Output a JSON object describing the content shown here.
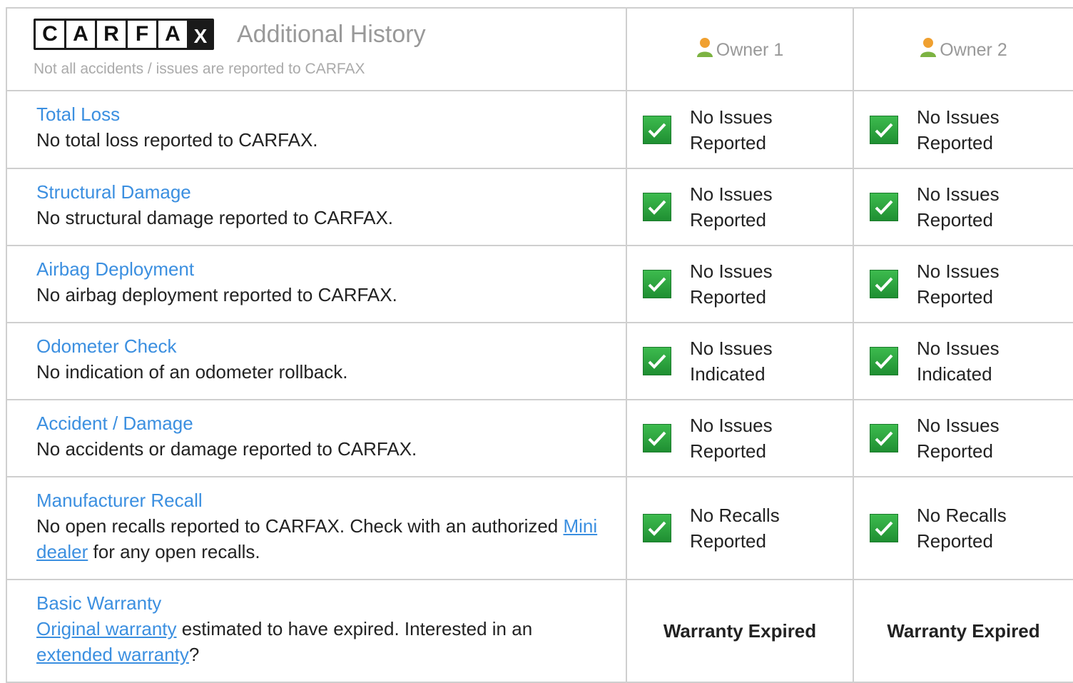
{
  "header": {
    "logo_letters": [
      "C",
      "A",
      "R",
      "F",
      "A",
      "X"
    ],
    "title": "Additional History",
    "subtitle": "Not all accidents / issues are reported to CARFAX",
    "owners": [
      "Owner 1",
      "Owner 2"
    ],
    "owner_icon": "person-icon",
    "owner_icon_colors": {
      "head": "#f0a030",
      "body": "#7cb342"
    }
  },
  "rows": [
    {
      "title": "Total Loss",
      "desc": "No total loss reported to CARFAX.",
      "status": [
        {
          "line1": "No Issues",
          "line2": "Reported"
        },
        {
          "line1": "No Issues",
          "line2": "Reported"
        }
      ]
    },
    {
      "title": "Structural Damage",
      "desc": "No structural damage reported to CARFAX.",
      "status": [
        {
          "line1": "No Issues",
          "line2": "Reported"
        },
        {
          "line1": "No Issues",
          "line2": "Reported"
        }
      ]
    },
    {
      "title": "Airbag Deployment",
      "desc": "No airbag deployment reported to CARFAX.",
      "status": [
        {
          "line1": "No Issues",
          "line2": "Reported"
        },
        {
          "line1": "No Issues",
          "line2": "Reported"
        }
      ]
    },
    {
      "title": "Odometer Check",
      "desc": "No indication of an odometer rollback.",
      "status": [
        {
          "line1": "No Issues",
          "line2": "Indicated"
        },
        {
          "line1": "No Issues",
          "line2": "Indicated"
        }
      ]
    },
    {
      "title": "Accident / Damage",
      "desc": "No accidents or damage reported to CARFAX.",
      "status": [
        {
          "line1": "No Issues",
          "line2": "Reported"
        },
        {
          "line1": "No Issues",
          "line2": "Reported"
        }
      ]
    },
    {
      "title": "Manufacturer Recall",
      "desc_pre": "No open recalls reported to CARFAX. Check with an authorized ",
      "desc_link": "Mini dealer",
      "desc_post": " for any open recalls.",
      "status": [
        {
          "line1": "No Recalls",
          "line2": "Reported"
        },
        {
          "line1": "No Recalls",
          "line2": "Reported"
        }
      ]
    },
    {
      "title": "Basic Warranty",
      "desc_link1": "Original warranty",
      "desc_mid": " estimated to have expired. Interested in an ",
      "desc_link2": "extended warranty",
      "desc_end": "?",
      "status": [
        "Warranty Expired",
        "Warranty Expired"
      ]
    }
  ],
  "colors": {
    "link": "#3b8fe0",
    "check_green": "#2aa53c",
    "border": "#cfcfcf",
    "muted_text": "#999999"
  }
}
